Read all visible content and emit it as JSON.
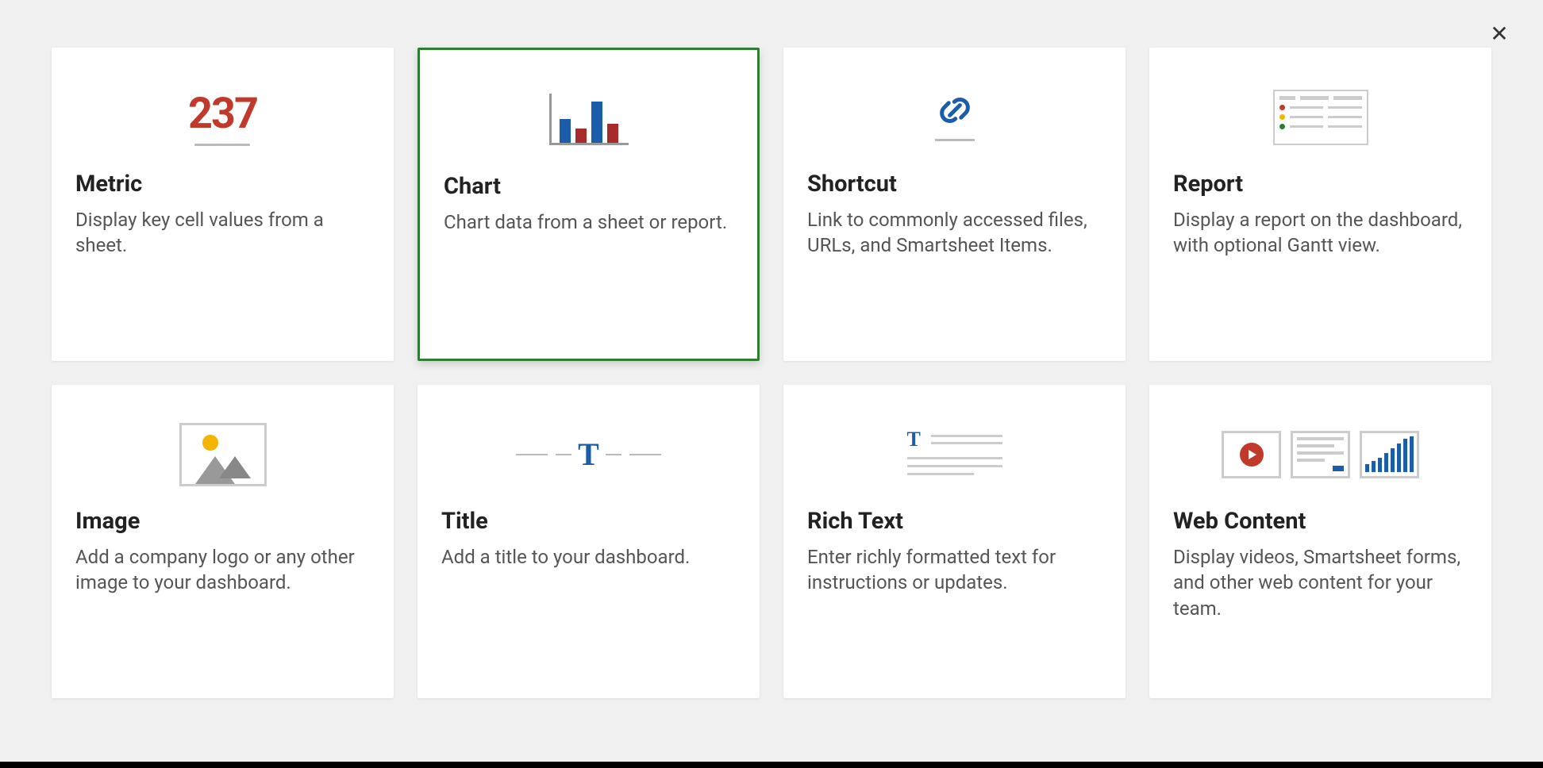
{
  "widgets": [
    {
      "id": "metric",
      "title": "Metric",
      "desc": "Display key cell values from a sheet.",
      "icon_value": "237",
      "selected": false
    },
    {
      "id": "chart",
      "title": "Chart",
      "desc": "Chart data from a sheet or report.",
      "selected": true
    },
    {
      "id": "shortcut",
      "title": "Shortcut",
      "desc": "Link to commonly accessed files, URLs, and Smartsheet Items.",
      "selected": false
    },
    {
      "id": "report",
      "title": "Report",
      "desc": "Display a report on the dashboard, with optional Gantt view.",
      "selected": false
    },
    {
      "id": "image",
      "title": "Image",
      "desc": "Add a company logo or any other image to your dashboard.",
      "selected": false
    },
    {
      "id": "title",
      "title": "Title",
      "desc": "Add a title to your dashboard.",
      "selected": false
    },
    {
      "id": "richtext",
      "title": "Rich Text",
      "desc": "Enter richly formatted text for instructions or updates.",
      "selected": false
    },
    {
      "id": "webcontent",
      "title": "Web Content",
      "desc": "Display videos, Smartsheet forms, and other web content for your team.",
      "selected": false
    }
  ],
  "close_label": "✕"
}
